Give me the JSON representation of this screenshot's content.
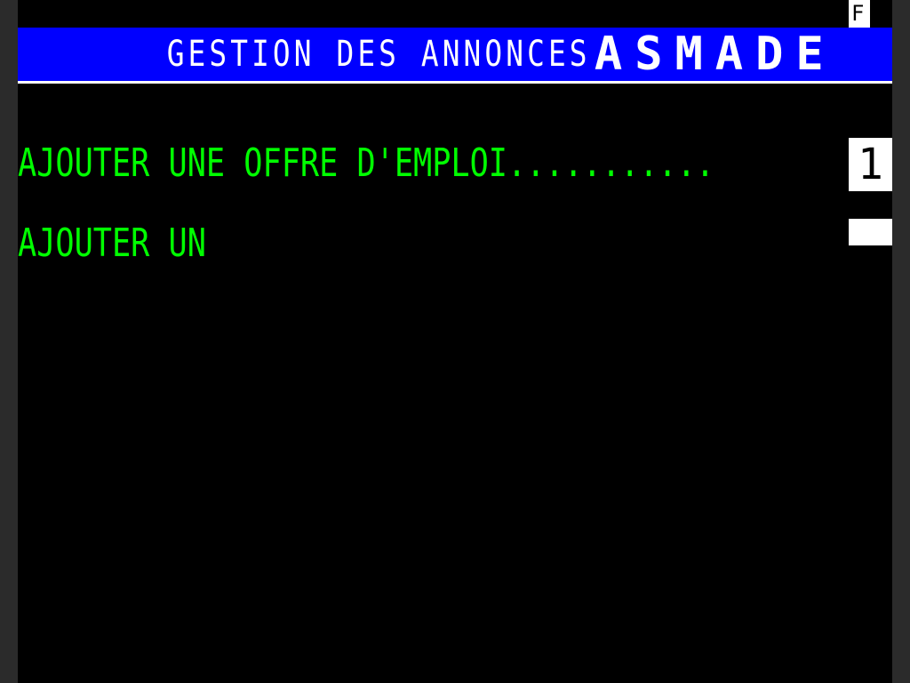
{
  "header": {
    "title_part1": "GESTION DES ANNONCES",
    "title_part2": "ASMADE"
  },
  "corner_badge": "F",
  "menu": {
    "items": [
      {
        "label": "AJOUTER UNE OFFRE D'EMPLOI...........",
        "key": "1"
      },
      {
        "label": "AJOUTER UN",
        "key": ""
      }
    ]
  },
  "colors": {
    "header_bg": "#0000ff",
    "menu_text": "#00ff00",
    "screen_bg": "#000000"
  }
}
